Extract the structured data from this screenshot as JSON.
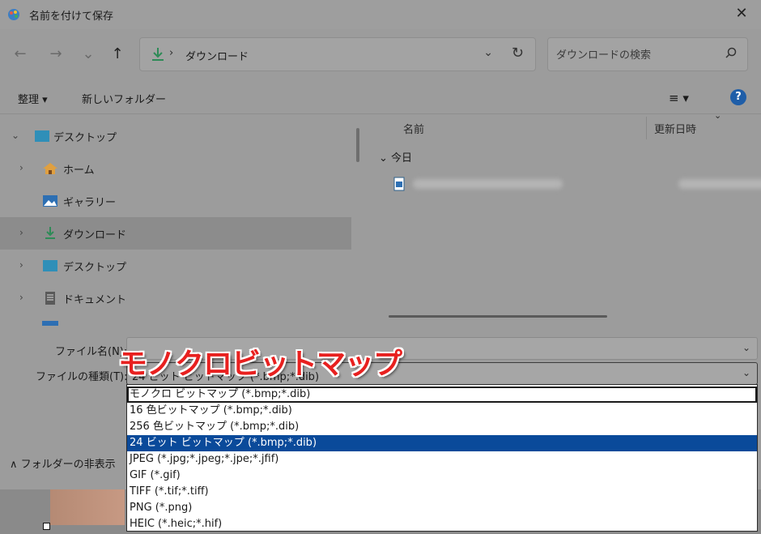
{
  "window": {
    "title": "名前を付けて保存",
    "close_label": "✕"
  },
  "nav": {
    "back": "←",
    "forward": "→",
    "recent": "⌄",
    "up": "↑"
  },
  "address": {
    "separator": "›",
    "path": "ダウンロード",
    "dropdown": "⌄",
    "refresh": "↻"
  },
  "search": {
    "placeholder": "ダウンロードの検索"
  },
  "toolbar": {
    "organize": "整理 ▾",
    "new_folder": "新しいフォルダー",
    "view": "≡ ▾",
    "help": "?"
  },
  "sidebar": {
    "items": [
      {
        "label": "デスクトップ",
        "chevron": "⌄"
      },
      {
        "label": "ホーム",
        "chevron": "›"
      },
      {
        "label": "ギャラリー",
        "chevron": ""
      },
      {
        "label": "ダウンロード",
        "chevron": "›"
      },
      {
        "label": "デスクトップ",
        "chevron": "›"
      },
      {
        "label": "ドキュメント",
        "chevron": "›"
      }
    ]
  },
  "content": {
    "columns": {
      "name": "名前",
      "modified": "更新日時",
      "sort_chevron": "⌄"
    },
    "group": "⌄ 今日"
  },
  "form": {
    "filename_label": "ファイル名(N):",
    "filename_value": "",
    "filetype_label": "ファイルの種類(T):",
    "filetype_value": "24 ビット ビットマップ (*.bmp;*.dib)",
    "arrow": "⌄"
  },
  "footer": {
    "hide_folders": "フォルダーの非表示",
    "hide_chevron": "∧"
  },
  "filetype_options": [
    "モノクロ ビットマップ (*.bmp;*.dib)",
    "16 色ビットマップ (*.bmp;*.dib)",
    "256 色ビットマップ (*.bmp;*.dib)",
    "24 ビット ビットマップ (*.bmp;*.dib)",
    "JPEG (*.jpg;*.jpeg;*.jpe;*.jfif)",
    "GIF (*.gif)",
    "TIFF (*.tif;*.tiff)",
    "PNG (*.png)",
    "HEIC (*.heic;*.hif)"
  ],
  "annotation": "モノクロビットマップ",
  "colors": {
    "selected": "#0a4a9a",
    "annotation": "#e8201f",
    "accent": "#2e8b57"
  }
}
